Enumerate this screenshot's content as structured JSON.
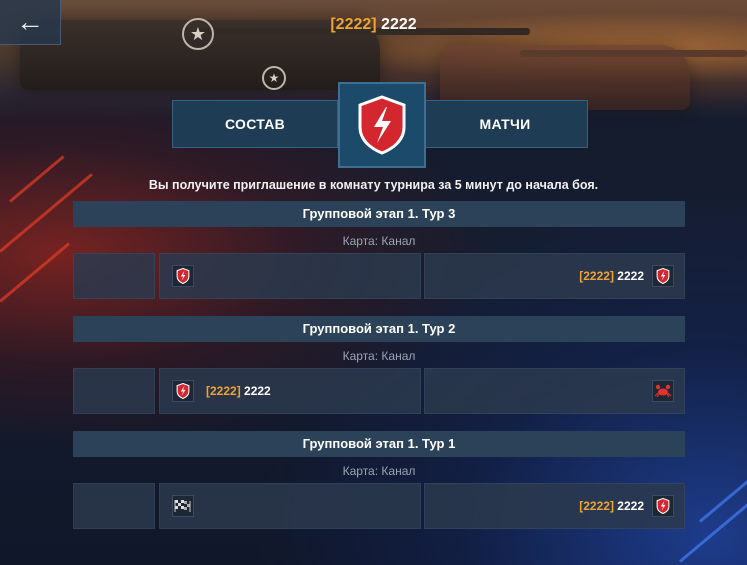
{
  "header": {
    "title_tag": "[2222]",
    "title_name": "2222"
  },
  "tabs": [
    {
      "label": "СОСТАВ"
    },
    {
      "label": "МАТЧИ"
    }
  ],
  "notice": "Вы получите приглашение в комнату турнира за 5 минут до начала боя.",
  "rounds": [
    {
      "title": "Групповой этап 1. Тур 3",
      "map": "Карта: Канал",
      "team_left": {
        "tag": "",
        "name": "",
        "icon": "wotb-shield-icon"
      },
      "team_right": {
        "tag": "[2222]",
        "name": "2222",
        "icon": "wotb-shield-icon"
      }
    },
    {
      "title": "Групповой этап 1. Тур 2",
      "map": "Карта: Канал",
      "team_left": {
        "tag": "[2222]",
        "name": "2222",
        "icon": "wotb-shield-icon"
      },
      "team_right": {
        "tag": "",
        "name": "",
        "icon": "crab-icon"
      }
    },
    {
      "title": "Групповой этап 1. Тур 1",
      "map": "Карта: Канал",
      "team_left": {
        "tag": "",
        "name": "",
        "icon": "checkered-flags-icon"
      },
      "team_right": {
        "tag": "[2222]",
        "name": "2222",
        "icon": "wotb-shield-icon"
      }
    }
  ],
  "colors": {
    "accent_gold": "#f0a330",
    "brand_red": "#d3262f",
    "panel": "#2b4258"
  }
}
